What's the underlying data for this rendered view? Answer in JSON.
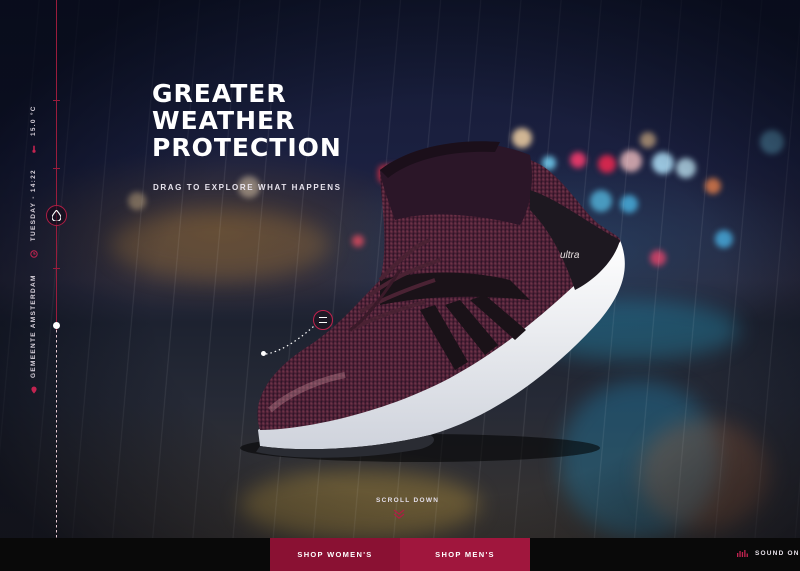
{
  "hero": {
    "headline_lines": [
      "GREATER",
      "WEATHER",
      "PROTECTION"
    ],
    "subline": "DRAG TO EXPLORE WHAT HAPPENS"
  },
  "side_info": {
    "location": "GEMEENTE AMSTERDAM",
    "day_time": "TUESDAY - 14:22",
    "temperature": "15.0 °C",
    "location_icon": "location-pin-icon",
    "time_icon": "clock-icon",
    "temperature_icon": "thermometer-icon"
  },
  "scroll": {
    "label": "SCROLL DOWN",
    "icon": "chevron-down-icon"
  },
  "footer": {
    "shop_women": "SHOP WOMEN'S",
    "shop_men": "SHOP MEN'S",
    "sound": "SOUND ON",
    "sound_icon": "sound-wave-icon"
  },
  "product": {
    "brand_mark": "ultra"
  },
  "colors": {
    "accent": "#a0163d",
    "accent_dark": "#8a1133",
    "footer_bg": "#090909"
  }
}
